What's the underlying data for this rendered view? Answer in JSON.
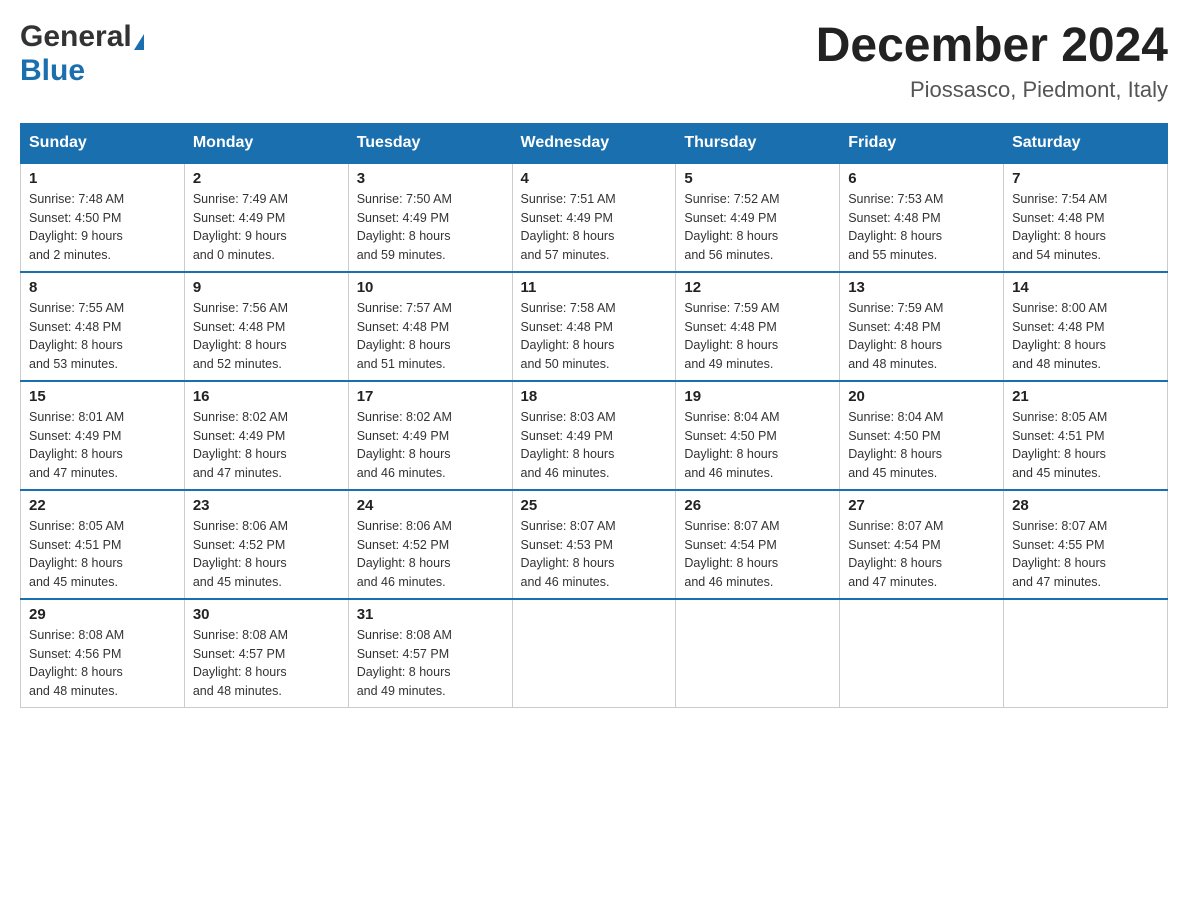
{
  "logo": {
    "general": "General",
    "blue": "Blue"
  },
  "header": {
    "month": "December 2024",
    "location": "Piossasco, Piedmont, Italy"
  },
  "days_of_week": [
    "Sunday",
    "Monday",
    "Tuesday",
    "Wednesday",
    "Thursday",
    "Friday",
    "Saturday"
  ],
  "weeks": [
    [
      {
        "day": "1",
        "sunrise": "7:48 AM",
        "sunset": "4:50 PM",
        "daylight": "9 hours and 2 minutes."
      },
      {
        "day": "2",
        "sunrise": "7:49 AM",
        "sunset": "4:49 PM",
        "daylight": "9 hours and 0 minutes."
      },
      {
        "day": "3",
        "sunrise": "7:50 AM",
        "sunset": "4:49 PM",
        "daylight": "8 hours and 59 minutes."
      },
      {
        "day": "4",
        "sunrise": "7:51 AM",
        "sunset": "4:49 PM",
        "daylight": "8 hours and 57 minutes."
      },
      {
        "day": "5",
        "sunrise": "7:52 AM",
        "sunset": "4:49 PM",
        "daylight": "8 hours and 56 minutes."
      },
      {
        "day": "6",
        "sunrise": "7:53 AM",
        "sunset": "4:48 PM",
        "daylight": "8 hours and 55 minutes."
      },
      {
        "day": "7",
        "sunrise": "7:54 AM",
        "sunset": "4:48 PM",
        "daylight": "8 hours and 54 minutes."
      }
    ],
    [
      {
        "day": "8",
        "sunrise": "7:55 AM",
        "sunset": "4:48 PM",
        "daylight": "8 hours and 53 minutes."
      },
      {
        "day": "9",
        "sunrise": "7:56 AM",
        "sunset": "4:48 PM",
        "daylight": "8 hours and 52 minutes."
      },
      {
        "day": "10",
        "sunrise": "7:57 AM",
        "sunset": "4:48 PM",
        "daylight": "8 hours and 51 minutes."
      },
      {
        "day": "11",
        "sunrise": "7:58 AM",
        "sunset": "4:48 PM",
        "daylight": "8 hours and 50 minutes."
      },
      {
        "day": "12",
        "sunrise": "7:59 AM",
        "sunset": "4:48 PM",
        "daylight": "8 hours and 49 minutes."
      },
      {
        "day": "13",
        "sunrise": "7:59 AM",
        "sunset": "4:48 PM",
        "daylight": "8 hours and 48 minutes."
      },
      {
        "day": "14",
        "sunrise": "8:00 AM",
        "sunset": "4:48 PM",
        "daylight": "8 hours and 48 minutes."
      }
    ],
    [
      {
        "day": "15",
        "sunrise": "8:01 AM",
        "sunset": "4:49 PM",
        "daylight": "8 hours and 47 minutes."
      },
      {
        "day": "16",
        "sunrise": "8:02 AM",
        "sunset": "4:49 PM",
        "daylight": "8 hours and 47 minutes."
      },
      {
        "day": "17",
        "sunrise": "8:02 AM",
        "sunset": "4:49 PM",
        "daylight": "8 hours and 46 minutes."
      },
      {
        "day": "18",
        "sunrise": "8:03 AM",
        "sunset": "4:49 PM",
        "daylight": "8 hours and 46 minutes."
      },
      {
        "day": "19",
        "sunrise": "8:04 AM",
        "sunset": "4:50 PM",
        "daylight": "8 hours and 46 minutes."
      },
      {
        "day": "20",
        "sunrise": "8:04 AM",
        "sunset": "4:50 PM",
        "daylight": "8 hours and 45 minutes."
      },
      {
        "day": "21",
        "sunrise": "8:05 AM",
        "sunset": "4:51 PM",
        "daylight": "8 hours and 45 minutes."
      }
    ],
    [
      {
        "day": "22",
        "sunrise": "8:05 AM",
        "sunset": "4:51 PM",
        "daylight": "8 hours and 45 minutes."
      },
      {
        "day": "23",
        "sunrise": "8:06 AM",
        "sunset": "4:52 PM",
        "daylight": "8 hours and 45 minutes."
      },
      {
        "day": "24",
        "sunrise": "8:06 AM",
        "sunset": "4:52 PM",
        "daylight": "8 hours and 46 minutes."
      },
      {
        "day": "25",
        "sunrise": "8:07 AM",
        "sunset": "4:53 PM",
        "daylight": "8 hours and 46 minutes."
      },
      {
        "day": "26",
        "sunrise": "8:07 AM",
        "sunset": "4:54 PM",
        "daylight": "8 hours and 46 minutes."
      },
      {
        "day": "27",
        "sunrise": "8:07 AM",
        "sunset": "4:54 PM",
        "daylight": "8 hours and 47 minutes."
      },
      {
        "day": "28",
        "sunrise": "8:07 AM",
        "sunset": "4:55 PM",
        "daylight": "8 hours and 47 minutes."
      }
    ],
    [
      {
        "day": "29",
        "sunrise": "8:08 AM",
        "sunset": "4:56 PM",
        "daylight": "8 hours and 48 minutes."
      },
      {
        "day": "30",
        "sunrise": "8:08 AM",
        "sunset": "4:57 PM",
        "daylight": "8 hours and 48 minutes."
      },
      {
        "day": "31",
        "sunrise": "8:08 AM",
        "sunset": "4:57 PM",
        "daylight": "8 hours and 49 minutes."
      },
      null,
      null,
      null,
      null
    ]
  ],
  "labels": {
    "sunrise": "Sunrise:",
    "sunset": "Sunset:",
    "daylight": "Daylight:"
  }
}
